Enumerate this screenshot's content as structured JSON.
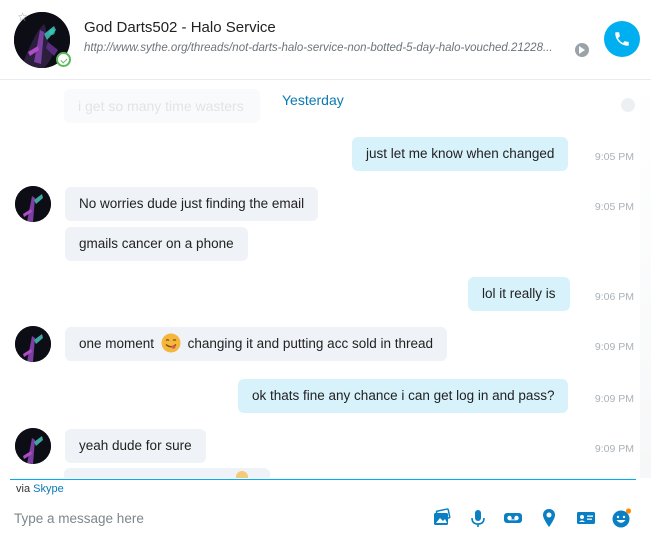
{
  "header": {
    "contact_name": "God Darts502 - Halo Service",
    "mood_link": "http://www.sythe.org/threads/not-darts-halo-service-non-botted-5-day-halo-vouched.21228...",
    "accent_color": "#00aff0"
  },
  "conversation": {
    "faded_message": "i get so many time wasters",
    "date_separator": "Yesterday",
    "messages": [
      {
        "direction": "out",
        "text": "just let me know when changed",
        "time": "9:05 PM"
      },
      {
        "direction": "in",
        "text": "No worries dude just finding the email",
        "time": "9:05 PM"
      },
      {
        "direction": "in",
        "text": "gmails cancer on a phone",
        "time": ""
      },
      {
        "direction": "out",
        "text": "lol it really is",
        "time": "9:06 PM"
      },
      {
        "direction": "in",
        "text_before": "one moment",
        "emoji": "savoring-food-emoji",
        "text_after": "changing it and putting acc sold in thread",
        "time": "9:09 PM"
      },
      {
        "direction": "out",
        "text": "ok thats fine any chance i can get log in and pass?",
        "time": "9:09 PM"
      },
      {
        "direction": "in",
        "text": "yeah dude for sure",
        "time": "9:09 PM"
      }
    ]
  },
  "footer": {
    "via_prefix": "via",
    "via_brand": "Skype",
    "compose_placeholder": "Type a message here",
    "tools": [
      "send-image-icon",
      "microphone-icon",
      "video-message-icon",
      "location-icon",
      "contact-card-icon",
      "emoticon-icon"
    ]
  }
}
